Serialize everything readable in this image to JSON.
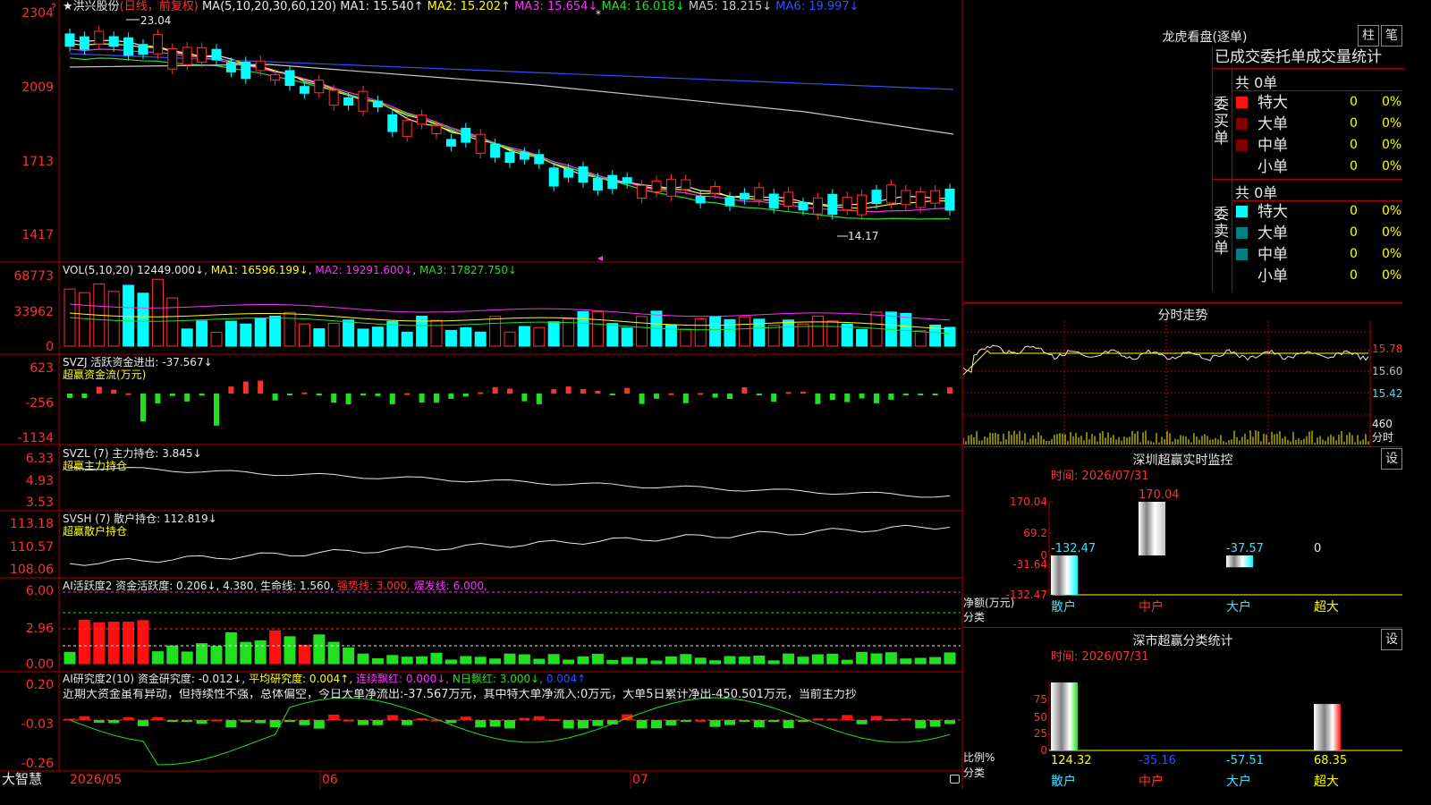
{
  "stock": {
    "name": "★洪兴股份",
    "mode": "(日线，前复权)",
    "ma_header": "MA(5,10,20,30,60,120)"
  },
  "ma": [
    {
      "label": "MA1: 15.540↑",
      "color": "#e8e8e8"
    },
    {
      "label": "MA2: 15.202↑",
      "color": "#ffff00"
    },
    {
      "label": "MA3: 15.654↓",
      "color": "#ff30ff"
    },
    {
      "label": "MA4: 16.018↓",
      "color": "#20e020"
    },
    {
      "label": "MA5: 18.215↓",
      "color": "#c8c8c8"
    },
    {
      "label": "MA6: 19.997↓",
      "color": "#3050ff"
    }
  ],
  "price_axis": [
    "2304",
    "2009",
    "1713",
    "1417"
  ],
  "price_marks": {
    "high": "23.04",
    "low": "14.17"
  },
  "vol": {
    "header": "VOL(5,10,20)",
    "val": "12449.000↓",
    "ma1": "MA1: 16596.199↓",
    "ma2": "MA2: 19291.600↓",
    "ma3": "MA3: 17827.750↓",
    "axis": [
      "68773",
      "33962",
      "0"
    ]
  },
  "svzj": {
    "header": "SVZJ  活跃资金进出: -37.567↓",
    "sub": "超赢资金流(万元)",
    "axis": [
      "623",
      "-256",
      "-1134"
    ]
  },
  "svzl": {
    "header": "SVZL (7) 主力持仓: 3.845↓",
    "sub": "超赢主力持仓",
    "axis": [
      "6.33",
      "4.93",
      "3.53"
    ]
  },
  "svsh": {
    "header": "SVSH (7) 散户持仓: 112.819↓",
    "sub": "超赢散户持仓",
    "axis": [
      "113.18",
      "110.57",
      "108.06"
    ]
  },
  "ai1": {
    "header": "AI活跃度2 资金活跃度: 0.206↓, 4.380, 生命线: 1.560,",
    "strong": "强势线: 3.000,",
    "burst": "爆发线: 6.000,",
    "axis": [
      "6.00",
      "2.96",
      "0.00"
    ]
  },
  "ai2": {
    "header": "AI研究度2(10) 资金研究度: -0.012↓,",
    "avg": "平均研究度: 0.004↑,",
    "cont": "连续飘红: 0.000↓,",
    "nday": "N日飘红: 3.000↓,",
    "last": "0.004↑",
    "text": "近期大资金虽有异动，但持续性不强，总体偏空，今日大单净流出:-37.567万元，其中特大单净流入:0万元，大单5日累计净出-450.501万元，当前主力抄",
    "axis": [
      "0.20",
      "-0.03",
      "-0.26"
    ]
  },
  "dates": [
    "2026/05",
    "06",
    "07"
  ],
  "brand": "大智慧",
  "dragon": {
    "title": "龙虎看盘(逐单)",
    "btn1": "柱",
    "btn2": "笔",
    "subtitle": "已成交委托单成交量统计",
    "buy": {
      "side": "委买单",
      "total": "共 0单",
      "rows": [
        {
          "name": "特大",
          "v": "0",
          "p": "0%",
          "color": "#ff1010"
        },
        {
          "name": "大单",
          "v": "0",
          "p": "0%",
          "color": "#800000"
        },
        {
          "name": "中单",
          "v": "0",
          "p": "0%",
          "color": "#800000"
        },
        {
          "name": "小单",
          "v": "0",
          "p": "0%",
          "color": "#000000"
        }
      ]
    },
    "sell": {
      "side": "委卖单",
      "total": "共 0单",
      "rows": [
        {
          "name": "特大",
          "v": "0",
          "p": "0%",
          "color": "#00ffff"
        },
        {
          "name": "大单",
          "v": "0",
          "p": "0%",
          "color": "#008080"
        },
        {
          "name": "中单",
          "v": "0",
          "p": "0%",
          "color": "#008080"
        },
        {
          "name": "小单",
          "v": "0",
          "p": "0%",
          "color": "#000000"
        }
      ]
    }
  },
  "intraday": {
    "title": "分时走势",
    "axis": [
      "15.78",
      "15.60",
      "15.42"
    ],
    "vol_label": "460",
    "unit": "分时"
  },
  "monitor": {
    "title": "深圳超赢实时监控",
    "btn": "设",
    "time": "时间: 2026/07/31",
    "axis": [
      "170.04",
      "69.2",
      "0",
      "-31.64",
      "-132.47"
    ],
    "ylabel": "净额(万元)",
    "xlabel": "分类",
    "bars": [
      {
        "cat": "散户",
        "value": -132.47,
        "label": "-132.47"
      },
      {
        "cat": "中户",
        "value": 170.04,
        "label": "170.04"
      },
      {
        "cat": "大户",
        "value": -37.57,
        "label": "-37.57"
      },
      {
        "cat": "超大",
        "value": 0,
        "label": "0"
      }
    ]
  },
  "classify": {
    "title": "深市超赢分类统计",
    "btn": "设",
    "time": "时间: 2026/07/31",
    "axis": [
      "75",
      "50",
      "25",
      "0"
    ],
    "ylabel": "比例%",
    "xlabel": "分类",
    "bars": [
      {
        "cat": "散户",
        "value": 124.32,
        "label": "124.32"
      },
      {
        "cat": "中户",
        "value": -35.16,
        "label": "-35.16"
      },
      {
        "cat": "大户",
        "value": -57.51,
        "label": "-57.51"
      },
      {
        "cat": "超大",
        "value": 68.35,
        "label": "68.35"
      }
    ]
  }
}
